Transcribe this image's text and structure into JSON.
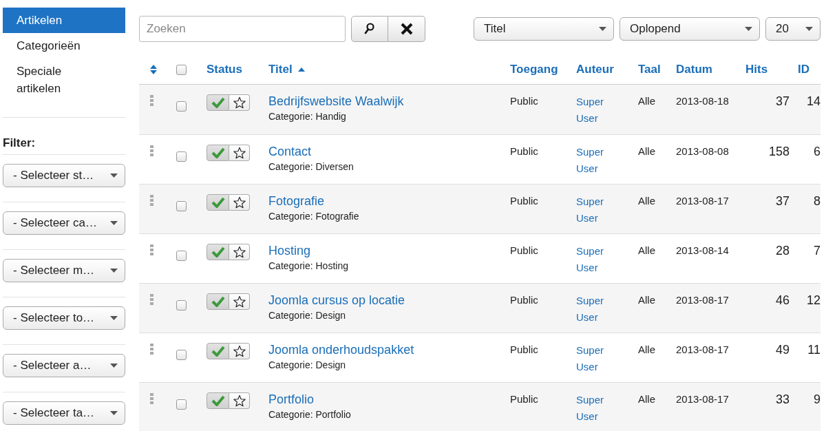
{
  "sidebar": {
    "items": [
      {
        "label": "Artikelen",
        "selected": true
      },
      {
        "label": "Categorieën",
        "selected": false
      },
      {
        "label": "Speciale artikelen",
        "selected": false
      }
    ],
    "filter_label": "Filter:",
    "filters": [
      {
        "value": "- Selecteer st…"
      },
      {
        "value": "- Selecteer ca…"
      },
      {
        "value": "- Selecteer m…"
      },
      {
        "value": "- Selecteer to…"
      },
      {
        "value": "- Selecteer a…"
      },
      {
        "value": "- Selecteer ta…"
      }
    ]
  },
  "toolbar": {
    "search": {
      "placeholder": "Zoeken"
    },
    "sort_field": {
      "value": "Titel"
    },
    "sort_order": {
      "value": "Oplopend"
    },
    "limit": {
      "value": "20"
    }
  },
  "table": {
    "select_all": {
      "checked": false
    },
    "columns": [
      {
        "label": "Status",
        "sorted": false
      },
      {
        "label": "Titel",
        "sorted": true
      },
      {
        "label": "Toegang",
        "sorted": false
      },
      {
        "label": "Auteur",
        "sorted": false
      },
      {
        "label": "Taal",
        "sorted": false
      },
      {
        "label": "Datum",
        "sorted": false
      },
      {
        "label": "Hits",
        "sorted": false
      },
      {
        "label": "ID",
        "sorted": false
      }
    ],
    "rows": [
      {
        "title": "Bedrijfswebsite Waalwijk",
        "category": "Categorie: Handig",
        "access": "Public",
        "author": "Super User",
        "language": "Alle",
        "date": "2013-08-18",
        "hits": "37",
        "id": "14",
        "published": true,
        "featured": false,
        "checked": false
      },
      {
        "title": "Contact",
        "category": "Categorie: Diversen",
        "access": "Public",
        "author": "Super User",
        "language": "Alle",
        "date": "2013-08-08",
        "hits": "158",
        "id": "6",
        "published": true,
        "featured": false,
        "checked": false
      },
      {
        "title": "Fotografie",
        "category": "Categorie: Fotografie",
        "access": "Public",
        "author": "Super User",
        "language": "Alle",
        "date": "2013-08-17",
        "hits": "37",
        "id": "8",
        "published": true,
        "featured": false,
        "checked": false
      },
      {
        "title": "Hosting",
        "category": "Categorie: Hosting",
        "access": "Public",
        "author": "Super User",
        "language": "Alle",
        "date": "2013-08-14",
        "hits": "28",
        "id": "7",
        "published": true,
        "featured": false,
        "checked": false
      },
      {
        "title": "Joomla cursus op locatie",
        "category": "Categorie: Design",
        "access": "Public",
        "author": "Super User",
        "language": "Alle",
        "date": "2013-08-17",
        "hits": "46",
        "id": "12",
        "published": true,
        "featured": false,
        "checked": false
      },
      {
        "title": "Joomla onderhoudspakket",
        "category": "Categorie: Design",
        "access": "Public",
        "author": "Super User",
        "language": "Alle",
        "date": "2013-08-17",
        "hits": "49",
        "id": "11",
        "published": true,
        "featured": false,
        "checked": false
      },
      {
        "title": "Portfolio",
        "category": "Categorie: Portfolio",
        "access": "Public",
        "author": "Super User",
        "language": "Alle",
        "date": "2013-08-17",
        "hits": "33",
        "id": "9",
        "published": true,
        "featured": false,
        "checked": false
      }
    ]
  }
}
